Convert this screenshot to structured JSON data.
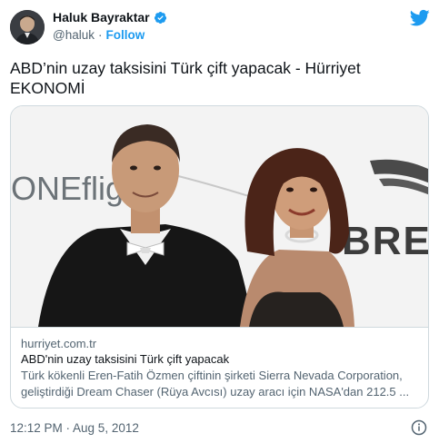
{
  "author": {
    "display_name": "Haluk Bayraktar",
    "handle": "@haluk",
    "dot": "·",
    "follow_label": "Follow",
    "verified_icon": "verified-badge-icon",
    "brand_icon": "twitter-bird-icon"
  },
  "tweet": {
    "text": "ABD’nin uzay taksisini Türk çift yapacak - Hürriyet EKONOMİ"
  },
  "card": {
    "image_text_left": "ONEflig",
    "image_text_right": "BRE",
    "domain": "hurriyet.com.tr",
    "title": "ABD'nin uzay taksisini Türk çift yapacak",
    "description_line1": "Türk kökenli Eren-Fatih Özmen çiftinin şirketi Sierra Nevada Corporation,",
    "description_line2": "geliştirdiği Dream Chaser (Rüya Avcısı) uzay aracı için NASA'dan 212.5 ..."
  },
  "footer": {
    "timestamp": "12:12 PM · Aug 5, 2012",
    "info_icon": "info-icon"
  },
  "colors": {
    "accent": "#1d9bf0",
    "text": "#0f1419",
    "secondary": "#536471",
    "border": "#cfd9de"
  }
}
